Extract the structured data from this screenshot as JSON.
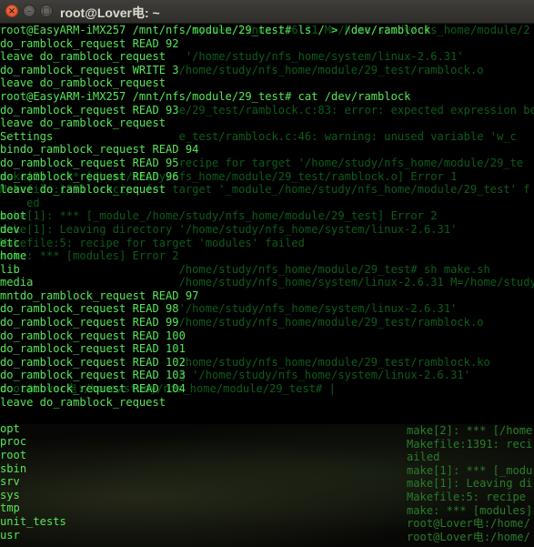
{
  "window": {
    "title": "root@Lover电: ~",
    "close_glyph": "×",
    "min_glyph": "–",
    "max_glyph": "□"
  },
  "terminal": {
    "foreground_color": "#58e658",
    "background_color": "#000000",
    "lines": [
      "root@EasyARM-iMX257 /mnt/nfs/module/29_test# ls / > /dev/ramblock",
      "do_ramblock_request READ 92",
      "leave do_ramblock_request",
      "do_ramblock_request WRITE 3",
      "leave do_ramblock_request",
      "root@EasyARM-iMX257 /mnt/nfs/module/29_test# cat /dev/ramblock",
      "do_ramblock_request READ 93",
      "leave do_ramblock_request",
      "Settings",
      "bindo_ramblock_request READ 94",
      "do_ramblock_request READ 95",
      "do_ramblock_request READ 96",
      "leave do_ramblock_request",
      "",
      "boot",
      "dev",
      "etc",
      "home",
      "lib",
      "media",
      "mntdo_ramblock_request READ 97",
      "do_ramblock_request READ 98",
      "do_ramblock_request READ 99",
      "do_ramblock_request READ 100",
      "do_ramblock_request READ 101",
      "do_ramblock_request READ 102",
      "do_ramblock_request READ 103",
      "do_ramblock_request READ 104",
      "leave do_ramblock_request",
      "",
      "opt",
      "proc",
      "root",
      "sbin",
      "srv",
      "sys",
      "tmp",
      "unit_tests",
      "usr"
    ],
    "background_lines": [
      "                            /system/linux-2.6.31 M=/home/study/nfs_home/module/2",
      "",
      "                            '/home/study/nfs_home/system/linux-2.6.31'",
      "                           /home/study/nfs_home/module/29_test/ramblock.o",
      "",
      "",
      "                           e/29_test/ramblock.c:83: error: expected expression be",
      "               e'",
      "                           e_test/ramblock.c:46: warning: unused variable 'w_c",
      "",
      "                           recipe for target '/home/study/nfs_home/module/29_te",
      "make[2]: *** [/home/study/nfs_home/module/29_test/ramblock.o] Error 1",
      "Makefile:1391: recipe for target '_module_/home/study/nfs_home/module/29_test' f",
      "    ed",
      "make[1]: *** [_module_/home/study/nfs_home/module/29_test] Error 2",
      "make[1]: Leaving directory '/home/study/nfs_home/system/linux-2.6.31'",
      "Makefile:5: recipe for target 'modules' failed",
      "make: *** [modules] Error 2",
      "                           /home/study/nfs_home/module/29_test# sh make.sh",
      "                           /home/study/nfs_home/system/linux-2.6.31 M=/home/study/nfs_home/module/2",
      "",
      "                           '/home/study/nfs_home/system/linux-2.6.31'",
      "                           /home/study/nfs_home/module/29_test/ramblock.o",
      "",
      "",
      "                           /home/study/nfs_home/module/29_test/ramblock.ko",
      "                           g '/home/study/nfs_home/system/linux-2.6.31'",
      "root@Lover电:/home/study/nfs_home/module/29_test# |"
    ],
    "side_lines": [
      "make[2]: *** [/home",
      "Makefile:1391: reci",
      "ailed",
      "make[1]: *** [_modu",
      "make[1]: Leaving di",
      "Makefile:5: recipe",
      "make: *** [modules]",
      "root@Lover电:/home/",
      "root@Lover电:/home/"
    ]
  }
}
